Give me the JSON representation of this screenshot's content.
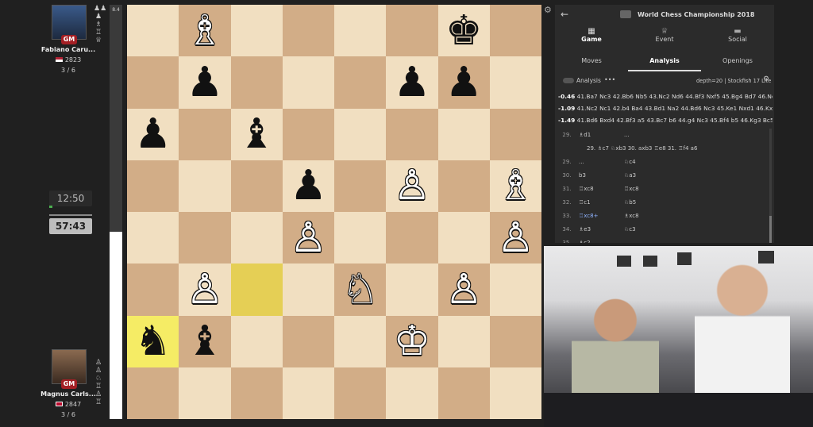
{
  "top_player": {
    "name": "Fabiano Caru...",
    "title": "GM",
    "rating": "2823",
    "score": "3 / 6",
    "clock": "12:50",
    "captured": [
      "♟♟",
      "♟",
      "♗",
      "♖",
      "♕"
    ]
  },
  "bottom_player": {
    "name": "Magnus Carls...",
    "title": "GM",
    "rating": "2847",
    "score": "3 / 6",
    "clock": "57:43",
    "captured": [
      "♙",
      "♙",
      "♘",
      "♖",
      "♙",
      "♖"
    ]
  },
  "eval_bar_label": "8.4",
  "board": {
    "ranks": [
      [
        "",
        "♗",
        "",
        "",
        "",
        "",
        "♚",
        ""
      ],
      [
        "",
        "♟",
        "",
        "",
        "",
        "♟",
        "♟",
        ""
      ],
      [
        "♟",
        "",
        "♝",
        "",
        "",
        "",
        "",
        ""
      ],
      [
        "",
        "",
        "",
        "♟",
        "",
        "♙",
        "",
        "♗"
      ],
      [
        "",
        "",
        "",
        "♙",
        "",
        "",
        "",
        "♙"
      ],
      [
        "",
        "♙",
        "",
        "",
        "♘",
        "",
        "♙",
        ""
      ],
      [
        "♞",
        "♝",
        "",
        "",
        "",
        "♔",
        "",
        ""
      ],
      [
        "",
        "",
        "",
        "",
        "",
        "",
        "",
        ""
      ]
    ],
    "white_pieces": [
      "♔",
      "♕",
      "♖",
      "♗",
      "♘",
      "♙"
    ],
    "highlight_squares": [
      "c3",
      "a2"
    ]
  },
  "panel": {
    "title": "World Chess Championship 2018",
    "top_tabs": [
      "Game",
      "Event",
      "Social"
    ],
    "sub_tabs": [
      "Moves",
      "Analysis",
      "Openings"
    ],
    "active_sub_tab": "Analysis",
    "analysis_toggle_label": "Analysis",
    "analysis_more": "•••",
    "engine_info": "depth=20 | Stockfish 17 Lite",
    "lines": [
      {
        "eval": "-0.46",
        "moves": "41.Ba7 Nc3 42.Bb6 Nb5 43.Nc2 Nd6 44.Bf3 Nxf5 45.Bg4 Bd7 46.Ne3 N..."
      },
      {
        "eval": "-1.09",
        "moves": "41.Nc2 Nc1 42.b4 Ba4 43.Bd1 Na2 44.Bd6 Nc3 45.Ke1 Nxd1 46.Kxd1 B..."
      },
      {
        "eval": "-1.49",
        "moves": "41.Bd6 Bxd4 42.Bf3 a5 43.Bc7 b6 44.g4 Nc3 45.Bf4 b5 46.Kg3 Bc5 47.N..."
      }
    ],
    "moves": [
      {
        "no": "29.",
        "white": "♗d1",
        "black": "..."
      },
      {
        "no": "",
        "white": "29. ♗c7  ♘xb3  30. axb3  ♖e8  31. ♖f4  a6",
        "black": ""
      },
      {
        "no": "29.",
        "white": "...",
        "black": "♘c4"
      },
      {
        "no": "30.",
        "white": "b3",
        "black": "♘a3"
      },
      {
        "no": "31.",
        "white": "♖xc8",
        "black": "♖xc8"
      },
      {
        "no": "32.",
        "white": "♖c1",
        "black": "♘b5"
      },
      {
        "no": "33.",
        "white": "♖xc8+",
        "black": "♗xc8"
      },
      {
        "no": "34.",
        "white": "♗e3",
        "black": "♘c3"
      },
      {
        "no": "35.",
        "white": "♗c2",
        "black": "..."
      }
    ]
  },
  "webcam_label": "webcam feed"
}
